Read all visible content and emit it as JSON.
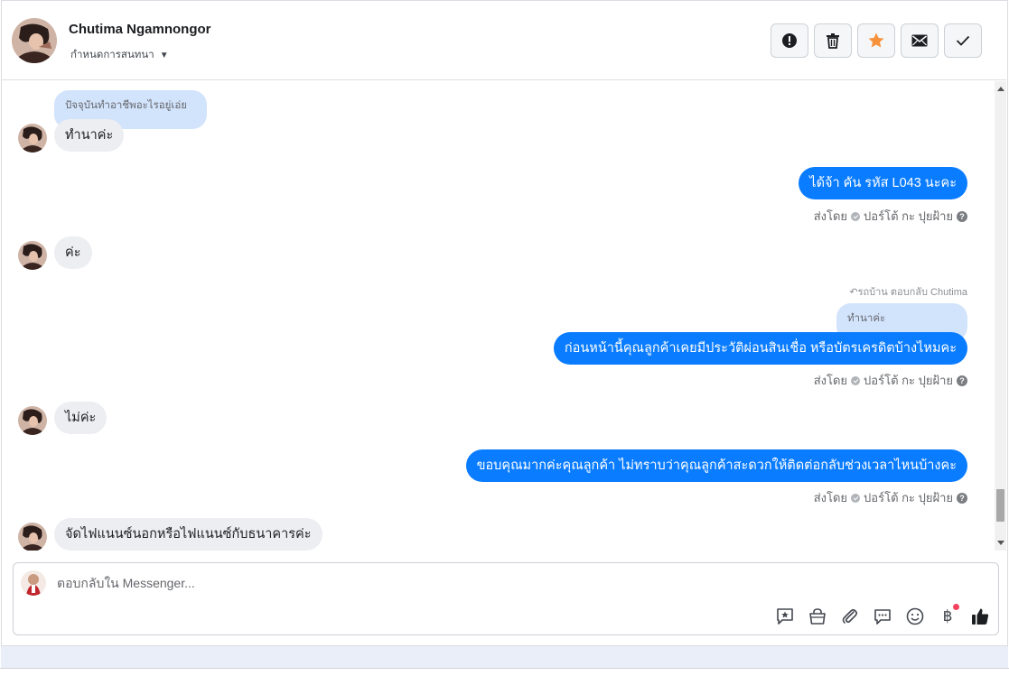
{
  "header": {
    "contact_name": "Chutima Ngamnongor",
    "assign_label": "กำหนดการสนทนา",
    "actions": [
      {
        "name": "mark-spam-button",
        "icon": "exclamation-icon"
      },
      {
        "name": "delete-button",
        "icon": "trash-icon"
      },
      {
        "name": "star-button",
        "icon": "star-icon",
        "color": "#f7923b"
      },
      {
        "name": "mark-unread-button",
        "icon": "envelope-icon"
      },
      {
        "name": "mark-done-button",
        "icon": "check-icon"
      }
    ]
  },
  "messages": {
    "m1_quote": "ปัจจุบันทำอาชีพอะไรอยู่เอ่ย",
    "m1_text": "ทำนาค่ะ",
    "m2_text": "ได้จ้า คัน รหัส L043 นะคะ",
    "m3_text": "ค่ะ",
    "m4_reply_note": "รถบ้าน ตอบกลับ Chutima",
    "m4_quote": "ทำนาค่ะ",
    "m4_text": "ก่อนหน้านี้คุณลูกค้าเคยมีประวัติผ่อนสินเชื่อ หรือบัตรเครดิตบ้างไหมคะ",
    "m5_text": "ไม่ค่ะ",
    "m6_text": "ขอบคุณมากค่ะคุณลูกค้า ไม่ทราบว่าคุณลูกค้าสะดวกให้ติดต่อกลับช่วงเวลาไหนบ้างคะ",
    "m7_text": "จัดไฟแนนซ์นอกหรือไฟแนนซ์กับธนาคารค่ะ"
  },
  "sent_by": {
    "prefix": "ส่งโดย",
    "agent": "ปอร์โต้ กะ ปุยฝ้าย"
  },
  "composer": {
    "placeholder": "ตอบกลับใน Messenger...",
    "tools": [
      "saved-reply-icon",
      "shop-bag-icon",
      "paperclip-icon",
      "chat-bubble-icon",
      "emoji-icon",
      "baht-icon",
      "like-icon"
    ],
    "baht_symbol": "฿"
  },
  "colors": {
    "outgoing_bubble": "#0a7cff",
    "incoming_bubble": "#eceef1",
    "quote_bubble": "#d2e3fc",
    "notification_dot": "#f3425f"
  }
}
